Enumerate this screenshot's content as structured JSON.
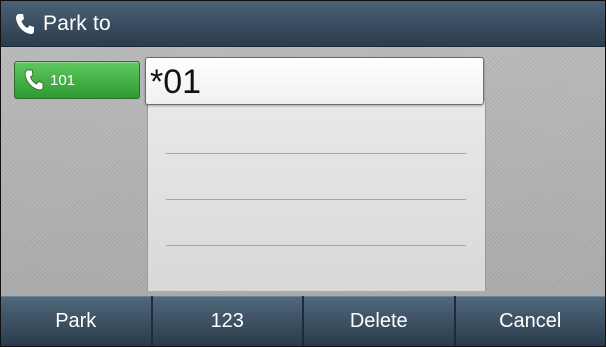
{
  "header": {
    "title": "Park to",
    "icon": "phone-handset-icon"
  },
  "line_key": {
    "label": "101",
    "icon": "phone-handset-icon",
    "color": "#3aa83c"
  },
  "input": {
    "value": "*01"
  },
  "softkeys": [
    {
      "label": "Park"
    },
    {
      "label": "123"
    },
    {
      "label": "Delete"
    },
    {
      "label": "Cancel"
    }
  ]
}
